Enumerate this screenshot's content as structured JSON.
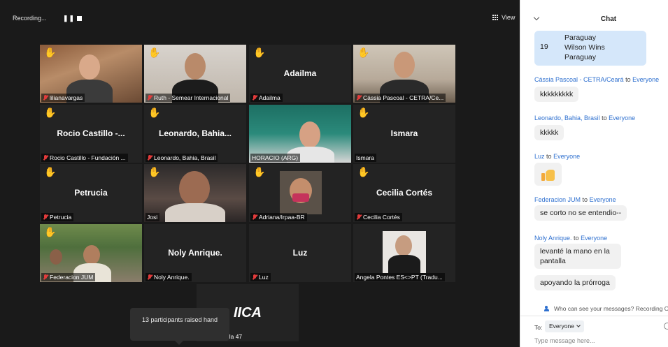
{
  "recording": {
    "label": "Recording...",
    "pause": "❚❚"
  },
  "view_button": {
    "label": "View"
  },
  "tiles": [
    {
      "name": "lilianavargas",
      "center": "",
      "hand": true
    },
    {
      "name": "Ruth - Semear Internacional",
      "center": "",
      "hand": true
    },
    {
      "name": "Adailma",
      "center": "Adailma",
      "hand": true
    },
    {
      "name": "Cássia Pascoal - CETRA/Ce...",
      "center": "",
      "hand": true
    },
    {
      "name": "Rocio Castillo - Fundación ...",
      "center": "Rocio Castillo -...",
      "hand": true
    },
    {
      "name": "Leonardo, Bahia, Brasil",
      "center": "Leonardo,  Bahia...",
      "hand": true
    },
    {
      "name": "HORACIO (ARG)",
      "center": "",
      "hand": false
    },
    {
      "name": "Ismara",
      "center": "Ismara",
      "hand": true
    },
    {
      "name": "Petrucia",
      "center": "Petrucia",
      "hand": true
    },
    {
      "name": "Josi",
      "center": "",
      "hand": true
    },
    {
      "name": "Adriana/Irpaa-BR",
      "center": "",
      "hand": true
    },
    {
      "name": "Cecilia Cortés",
      "center": "Cecilia Cortés",
      "hand": true
    },
    {
      "name": "Federacion JUM",
      "center": "",
      "hand": true
    },
    {
      "name": "Noly Anrique.",
      "center": "Noly Anrique.",
      "hand": false
    },
    {
      "name": "Luz",
      "center": "Luz",
      "hand": false
    },
    {
      "name": "Angela Pontes ES<>PT (Tradu...",
      "center": "",
      "hand": false
    },
    {
      "name": "ala 47",
      "center": "IICA",
      "hand": false
    }
  ],
  "tooltip": {
    "text": "13 participants raised hand"
  },
  "chat": {
    "title": "Chat",
    "quoted": {
      "number": "19",
      "line1": "Paraguay",
      "line2": "Wilson Wins",
      "line3": "Paraguay"
    },
    "messages": [
      {
        "sender": "Cássia Pascoal - CETRA/Ceará",
        "to": "to",
        "target": "Everyone",
        "text": "kkkkkkkkk"
      },
      {
        "sender": "Leonardo, Bahia, Brasil",
        "to": "to",
        "target": "Everyone",
        "text": "kkkkk"
      },
      {
        "sender": "Luz",
        "to": "to",
        "target": "Everyone",
        "text": ""
      },
      {
        "sender": "Federacion JUM",
        "to": "to",
        "target": "Everyone",
        "text": "se corto no se entendio--"
      },
      {
        "sender": "Noly Anrique.",
        "to": "to",
        "target": "Everyone",
        "text": "levanté la mano en la pantalla"
      },
      {
        "sender": "",
        "to": "",
        "target": "",
        "text": "apoyando la prórroga"
      }
    ],
    "privacy": "Who can see your messages? Recording O",
    "to_label": "To:",
    "to_value": "Everyone",
    "input_placeholder": "Type message here..."
  }
}
